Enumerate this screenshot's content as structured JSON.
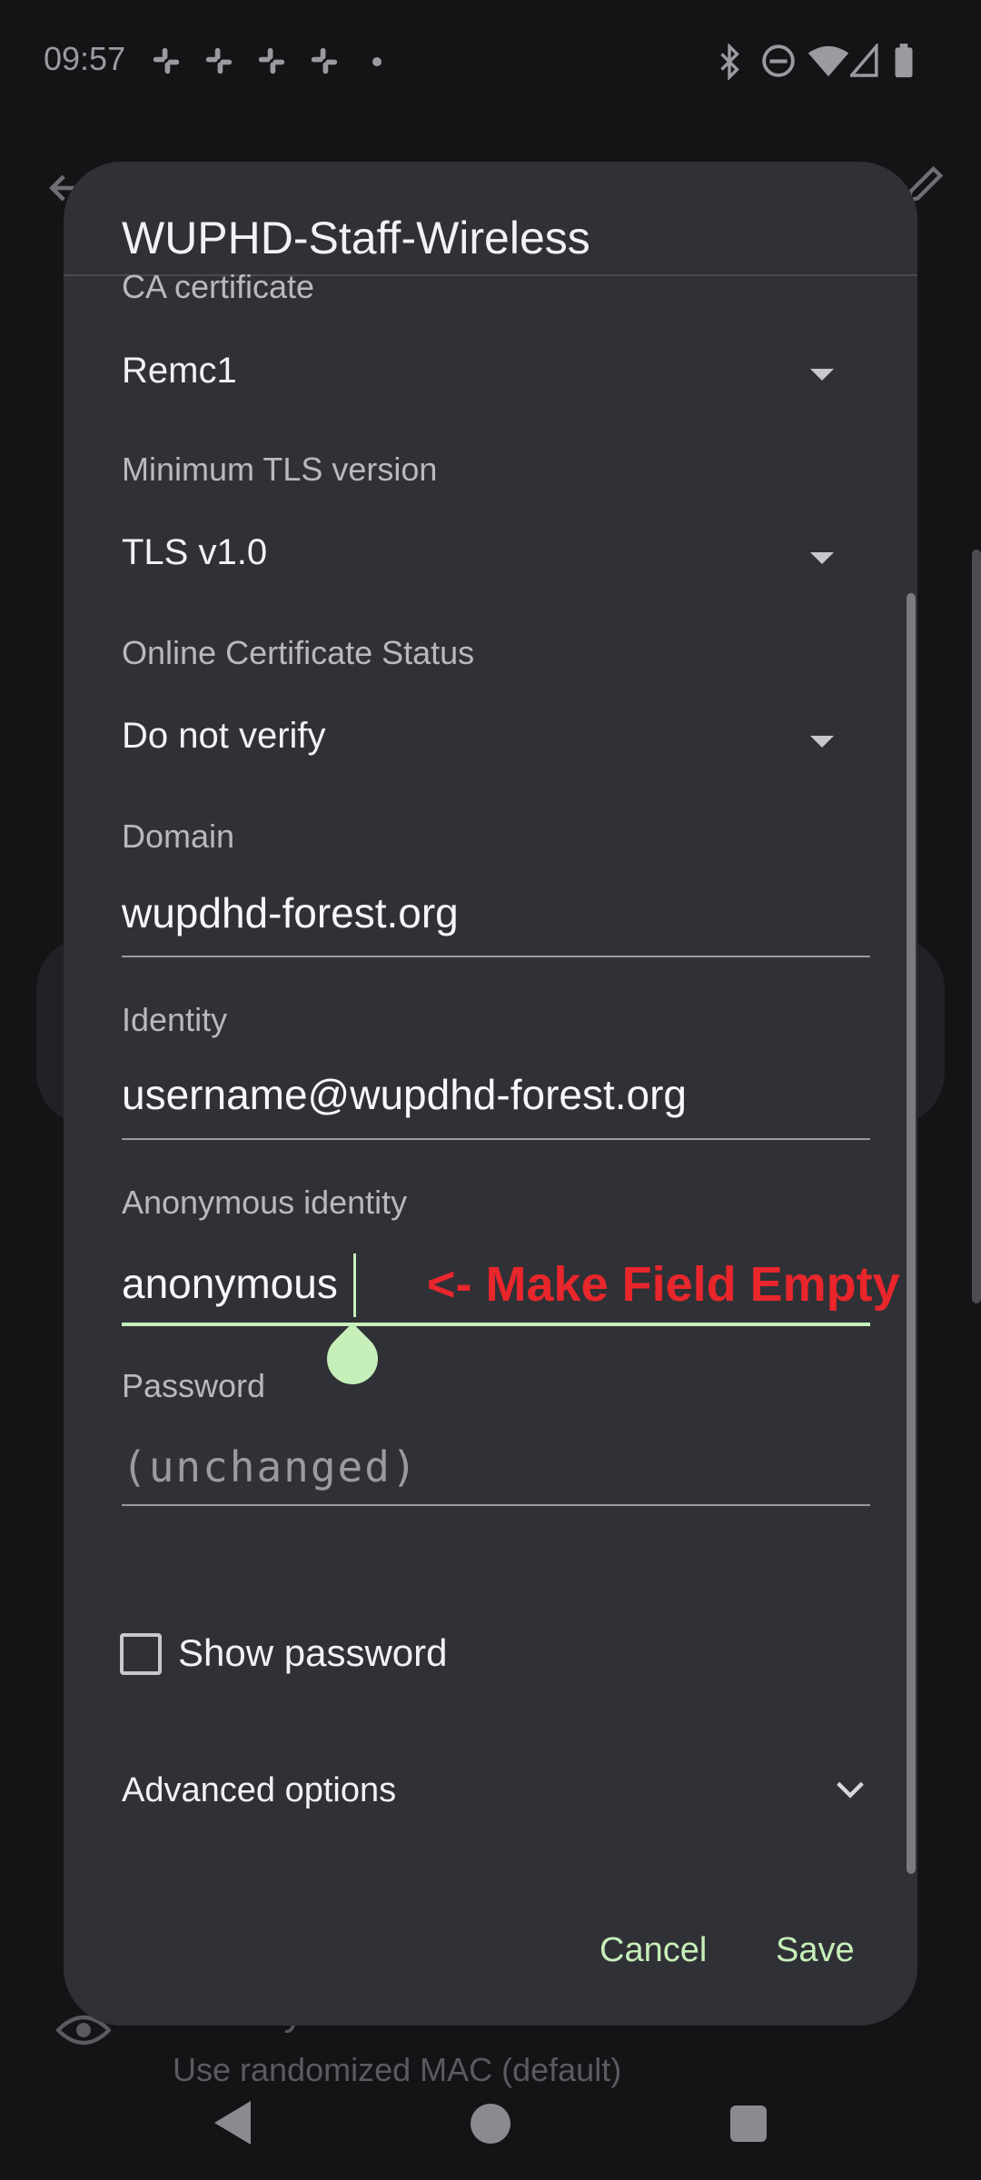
{
  "status_bar": {
    "time": "09:57",
    "notification_icons": [
      "slack-icon",
      "slack-icon",
      "slack-icon",
      "slack-icon"
    ],
    "system_icons": [
      "bluetooth-icon",
      "do-not-disturb-icon",
      "wifi-icon",
      "cellular-icon",
      "battery-icon"
    ]
  },
  "background": {
    "privacy_title": "Privacy",
    "privacy_subtitle": "Use randomized MAC (default)"
  },
  "dialog": {
    "title": "WUPHD-Staff-Wireless",
    "ca_certificate": {
      "label": "CA certificate",
      "value": "Remc1"
    },
    "min_tls": {
      "label": "Minimum TLS version",
      "value": "TLS v1.0"
    },
    "ocsp": {
      "label": "Online Certificate Status",
      "value": "Do not verify"
    },
    "domain": {
      "label": "Domain",
      "value": "wupdhd-forest.org"
    },
    "identity": {
      "label": "Identity",
      "value": "username@wupdhd-forest.org"
    },
    "anonymous_identity": {
      "label": "Anonymous identity",
      "value": "anonymous"
    },
    "password": {
      "label": "Password",
      "placeholder": "(unchanged)"
    },
    "show_password": "Show password",
    "advanced_options": "Advanced options",
    "cancel": "Cancel",
    "save": "Save"
  },
  "annotation": {
    "text": "<- Make Field Empty",
    "color": "#e8262b"
  },
  "colors": {
    "accent": "#c6efb9",
    "dialog_bg": "#303136"
  }
}
